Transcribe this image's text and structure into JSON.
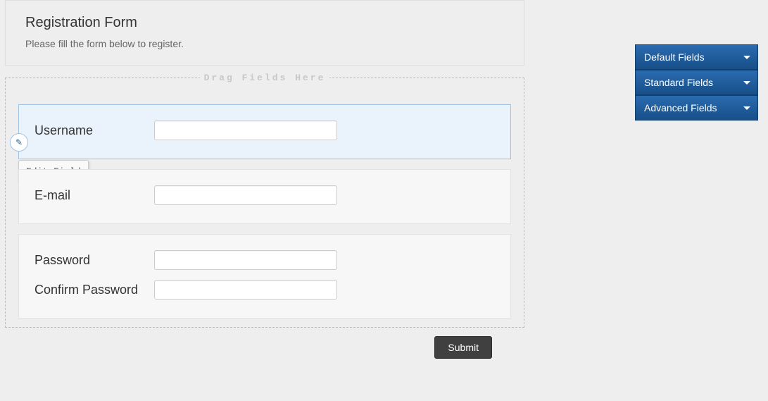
{
  "header": {
    "title": "Registration Form",
    "subtitle": "Please fill the form below to register."
  },
  "dropzone": {
    "legend": "Drag Fields Here"
  },
  "fields": {
    "username": {
      "label": "Username",
      "value": ""
    },
    "email": {
      "label": "E-mail",
      "value": ""
    },
    "password": {
      "label": "Password",
      "value": ""
    },
    "confirm_password": {
      "label": "Confirm Password",
      "value": ""
    }
  },
  "edit_tooltip": "Edit Field",
  "submit_label": "Submit",
  "panels": {
    "default": "Default Fields",
    "standard": "Standard Fields",
    "advanced": "Advanced Fields"
  }
}
